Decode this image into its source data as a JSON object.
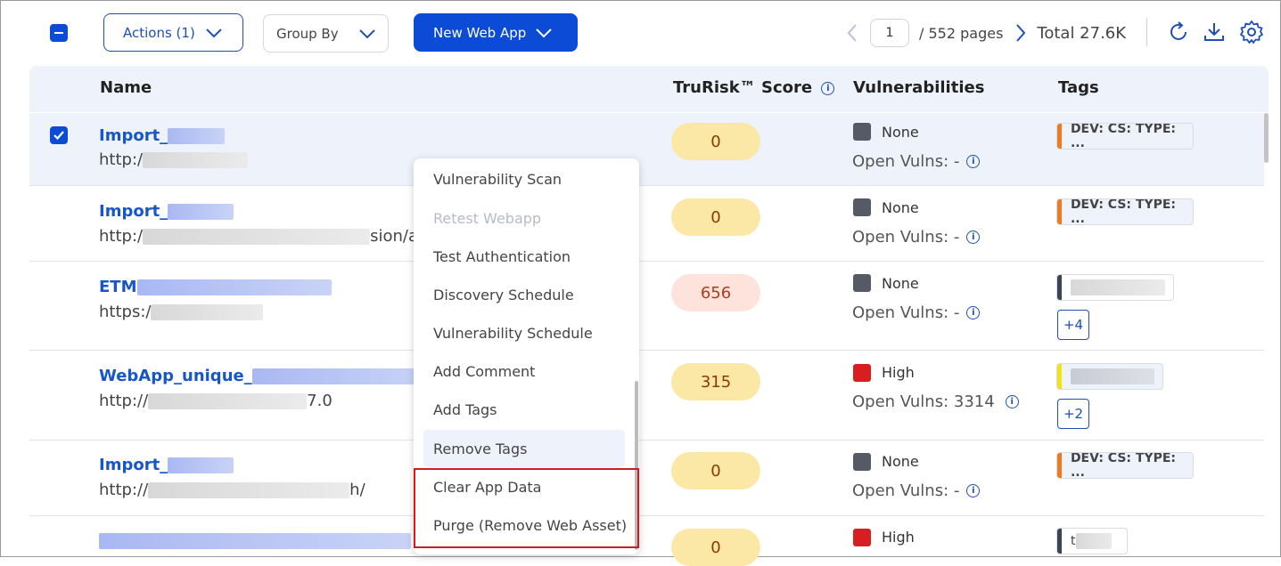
{
  "toolbar": {
    "actions_label": "Actions (1)",
    "group_by_label": "Group By",
    "new_web_app_label": "New Web App",
    "page_value": "1",
    "pages_label": "/  552 pages",
    "total_label": "Total 27.6K"
  },
  "table": {
    "headers": {
      "name": "Name",
      "score": "TruRisk™ Score",
      "vulns": "Vulnerabilities",
      "tags": "Tags"
    },
    "rows": [
      {
        "name": "Import_",
        "url": "http:/",
        "url_tail": "",
        "score": "0",
        "severity": "None",
        "open_vulns": "Open Vulns: -",
        "tag": "DEV: CS: TYPE: ...",
        "more": ""
      },
      {
        "name": "Import_",
        "url": "http:/",
        "url_tail": "sion/a",
        "score": "0",
        "severity": "None",
        "open_vulns": "Open Vulns: -",
        "tag": "DEV: CS: TYPE: ...",
        "more": ""
      },
      {
        "name": "ETM",
        "url": "https:/",
        "url_tail": "",
        "score": "656",
        "severity": "None",
        "open_vulns": "Open Vulns: -",
        "tag": "",
        "more": "+4"
      },
      {
        "name": "WebApp_unique_",
        "url": "http://",
        "url_tail": "7.0",
        "score": "315",
        "severity": "High",
        "open_vulns": "Open Vulns: 3314",
        "tag": "",
        "more": "+2"
      },
      {
        "name": "Import_",
        "url": "http://",
        "url_tail": "h/",
        "score": "0",
        "severity": "None",
        "open_vulns": "Open Vulns: -",
        "tag": "DEV: CS: TYPE: ...",
        "more": ""
      },
      {
        "name": "",
        "url": "",
        "url_tail": "",
        "score": "0",
        "severity": "High",
        "open_vulns": "",
        "tag": "t",
        "more": ""
      }
    ]
  },
  "menu": {
    "items": [
      "Vulnerability Scan",
      "Retest Webapp",
      "Test Authentication",
      "Discovery Schedule",
      "Vulnerability Schedule",
      "Add Comment",
      "Add Tags",
      "Remove Tags",
      "Clear App Data",
      "Purge (Remove Web Asset)"
    ]
  },
  "colors": {
    "primary": "#0b4bd6",
    "link": "#1656c8",
    "severity_none": "#555a66",
    "severity_high": "#d81e1e",
    "score_low_bg": "#fbe7a6",
    "score_high_bg": "#fde3dc",
    "tag_orange": "#f07a1f",
    "tag_dark": "#3a4556",
    "tag_yellow": "#f2e40f",
    "highlight_box": "#d01c1c"
  }
}
